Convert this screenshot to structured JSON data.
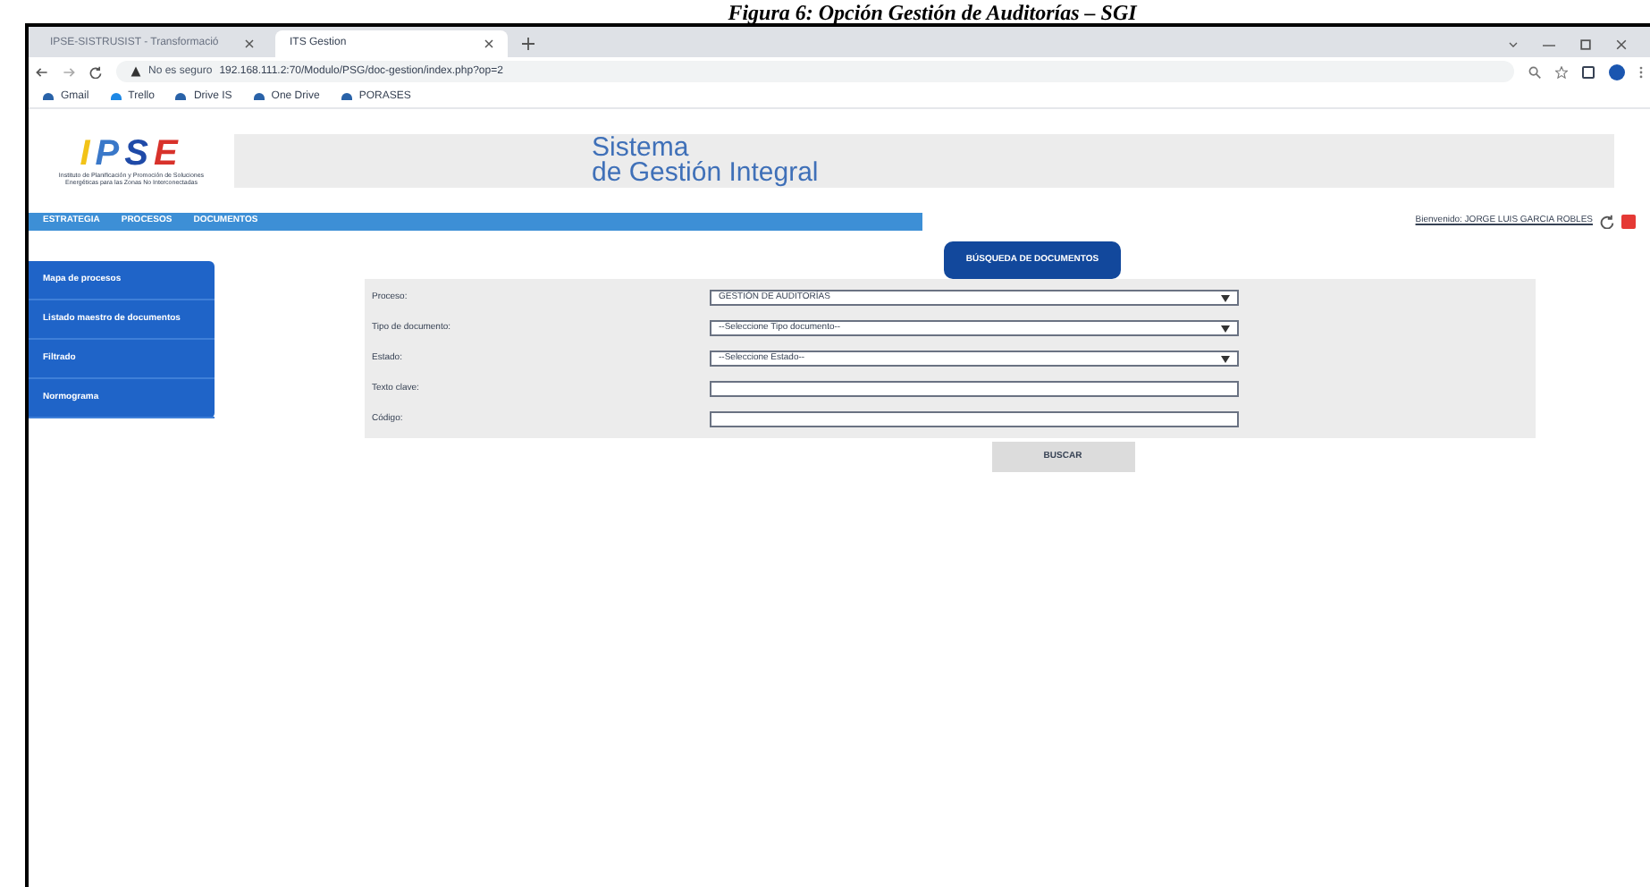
{
  "caption": "Figura 6: Opción Gestión de Auditorías – SGI",
  "browser": {
    "tabs": [
      {
        "title": "IPSE-SISTRUSIST - Transformació",
        "selected": false
      },
      {
        "title": "ITS Gestion",
        "selected": true
      }
    ],
    "security": "No es seguro",
    "url": "192.168.111.2:70/Modulo/PSG/doc-gestion/index.php?op=2",
    "bookmarks": [
      "Gmail",
      "Trello",
      "Drive IS",
      "One Drive",
      "PORASES"
    ]
  },
  "header": {
    "logo": "IPSE",
    "logo_subtitle": "Instituto de Planificación y Promoción de Soluciones Energéticas para las Zonas No Interconectadas",
    "title_line_1": "Sistema",
    "title_line_2": "de Gestión Integral"
  },
  "nav": {
    "items": [
      "ESTRATEGIA",
      "PROCESOS",
      "DOCUMENTOS"
    ],
    "user": "Bienvenido: JORGE LUIS GARCIA ROBLES"
  },
  "sidebar": {
    "items": [
      "Mapa de procesos",
      "Listado maestro de documentos",
      "Filtrado",
      "Normograma"
    ]
  },
  "search_title": "BÚSQUEDA DE DOCUMENTOS",
  "form": {
    "fields": [
      {
        "label": "Proceso:",
        "kind": "select",
        "value": "GESTIÓN DE AUDITORÍAS"
      },
      {
        "label": "Tipo de documento:",
        "kind": "select",
        "value": "--Seleccione Tipo documento--"
      },
      {
        "label": "Estado:",
        "kind": "select",
        "value": "--Seleccione Estado--"
      },
      {
        "label": "Texto clave:",
        "kind": "text"
      },
      {
        "label": "Código:",
        "kind": "text"
      }
    ]
  },
  "search_button": "BUSCAR"
}
